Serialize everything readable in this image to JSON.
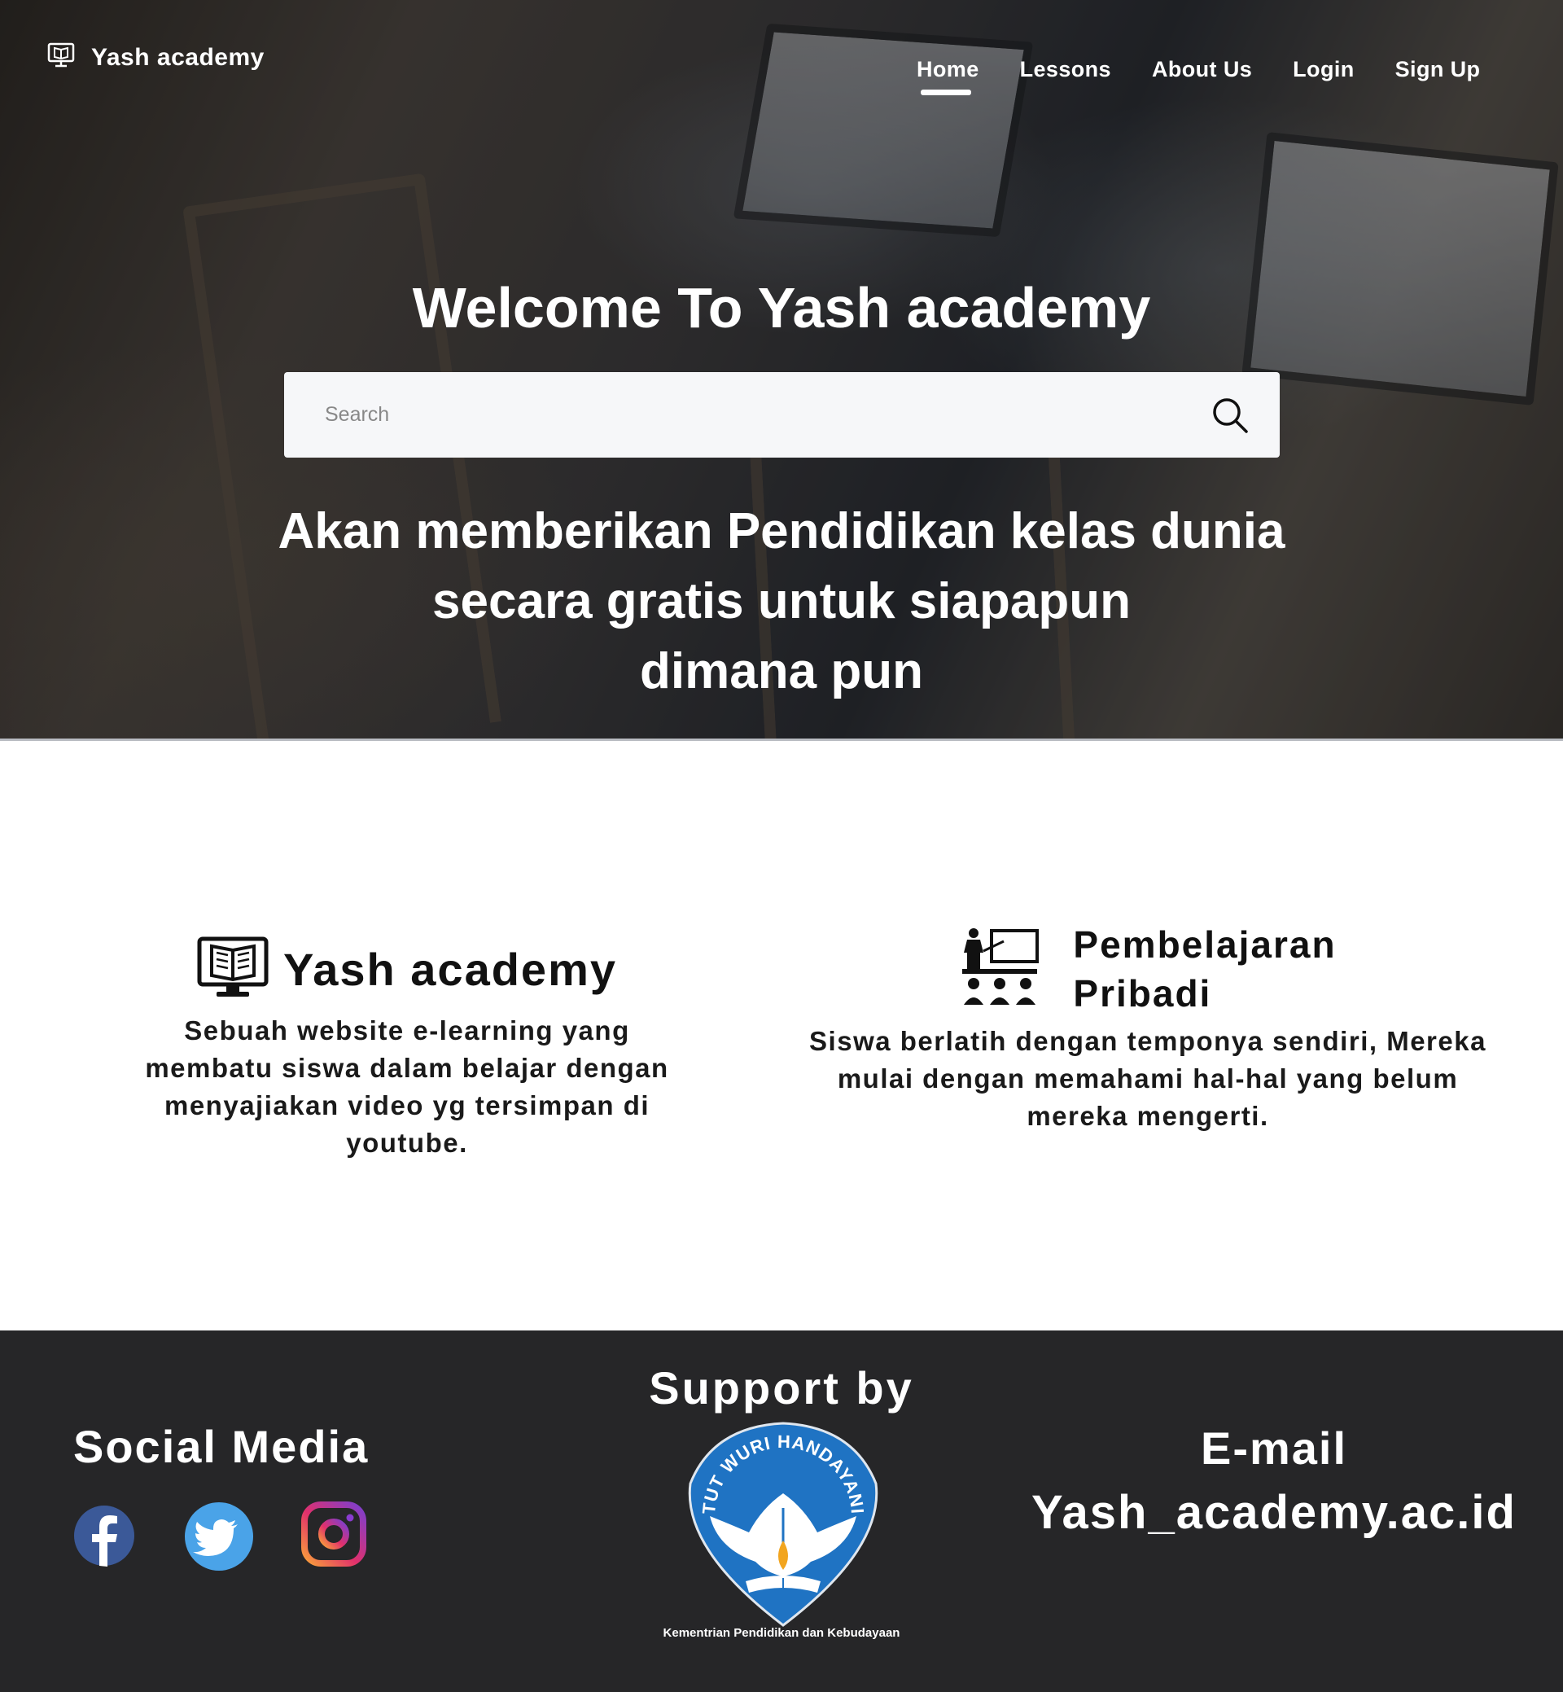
{
  "brand": {
    "name": "Yash academy",
    "icon": "monitor-book-icon"
  },
  "nav": {
    "items": [
      {
        "label": "Home",
        "active": true
      },
      {
        "label": "Lessons",
        "active": false
      },
      {
        "label": "About Us",
        "active": false
      },
      {
        "label": "Login",
        "active": false
      },
      {
        "label": "Sign Up",
        "active": false
      }
    ]
  },
  "hero": {
    "title": "Welcome To Yash academy",
    "search": {
      "placeholder": "Search",
      "value": "",
      "icon": "search-icon"
    },
    "tagline": [
      "Akan memberikan Pendidikan kelas dunia",
      "secara gratis untuk siapapun",
      "dimana pun"
    ]
  },
  "features": {
    "left": {
      "icon": "monitor-book-icon",
      "title": "Yash academy",
      "description": "Sebuah website e-learning yang membatu siswa dalam belajar dengan menyajiakan video yg tersimpan di youtube."
    },
    "right": {
      "icon": "classroom-teacher-icon",
      "title_line1": "Pembelajaran",
      "title_line2": "Pribadi",
      "description": "Siswa berlatih dengan temponya sendiri, Mereka mulai dengan memahami hal-hal yang belum mereka mengerti."
    }
  },
  "footer": {
    "social": {
      "title": "Social Media",
      "icons": [
        "facebook-icon",
        "twitter-icon",
        "instagram-icon"
      ]
    },
    "support": {
      "title": "Support by",
      "logo_text": "TUT WURI HANDAYANI",
      "caption": "Kementrian Pendidikan dan Kebudayaan"
    },
    "email": {
      "title": "E-mail",
      "value": "Yash_academy.ac.id"
    }
  },
  "colors": {
    "footer_bg": "#262628",
    "facebook": "#3b5998",
    "twitter": "#1da1f2",
    "kemdikbud_blue": "#1f73c3"
  }
}
